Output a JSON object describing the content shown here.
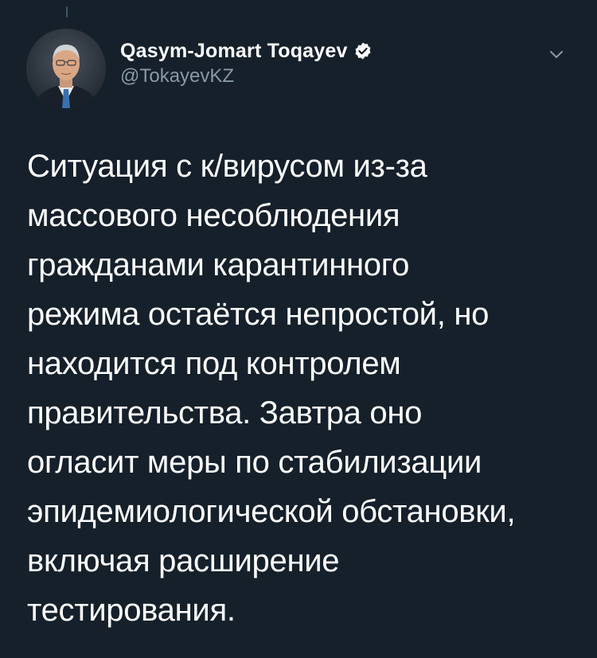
{
  "tweet": {
    "author": {
      "display_name": "Qasym-Jomart Toqayev",
      "handle": "@TokayevKZ",
      "verified": true,
      "avatar_icon": "profile-photo"
    },
    "menu_icon": "chevron-down-icon",
    "text": "Ситуация с к/вирусом из-за\nмассового несоблюдения\nгражданами карантинного\nрежима остаётся непростой, но\nнаходится под контролем\nправительства. Завтра оно\nогласит меры по стабилизации\nэпидемиологической обстановки,\nвключая расширение\nтестирования."
  },
  "colors": {
    "background": "#15202b",
    "text_primary": "#ffffff",
    "text_secondary": "#8899a6",
    "verified_badge": "#ffffff",
    "thread_line": "#3d5466"
  }
}
